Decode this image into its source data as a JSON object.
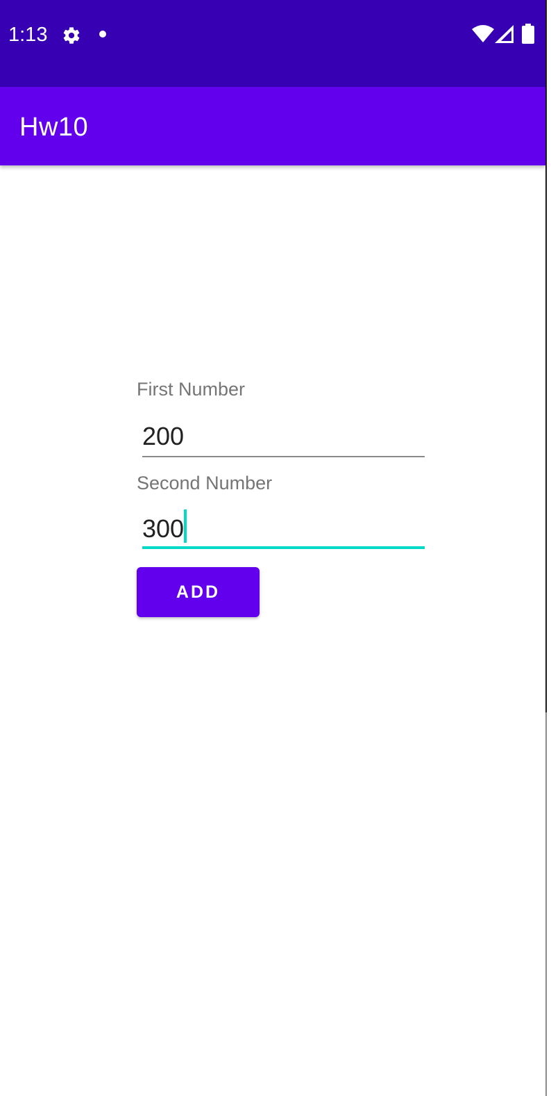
{
  "status_bar": {
    "time": "1:13",
    "icons": [
      "gear-icon",
      "dot-icon",
      "wifi-icon",
      "signal-icon",
      "battery-icon"
    ]
  },
  "app_bar": {
    "title": "Hw10"
  },
  "form": {
    "first_label": "First Number",
    "first_value": "200",
    "second_label": "Second Number",
    "second_value": "300",
    "add_label": "ADD"
  },
  "colors": {
    "status_bar": "#3700b3",
    "app_bar": "#6200ee",
    "accent": "#03dac5",
    "button": "#6200ee"
  }
}
